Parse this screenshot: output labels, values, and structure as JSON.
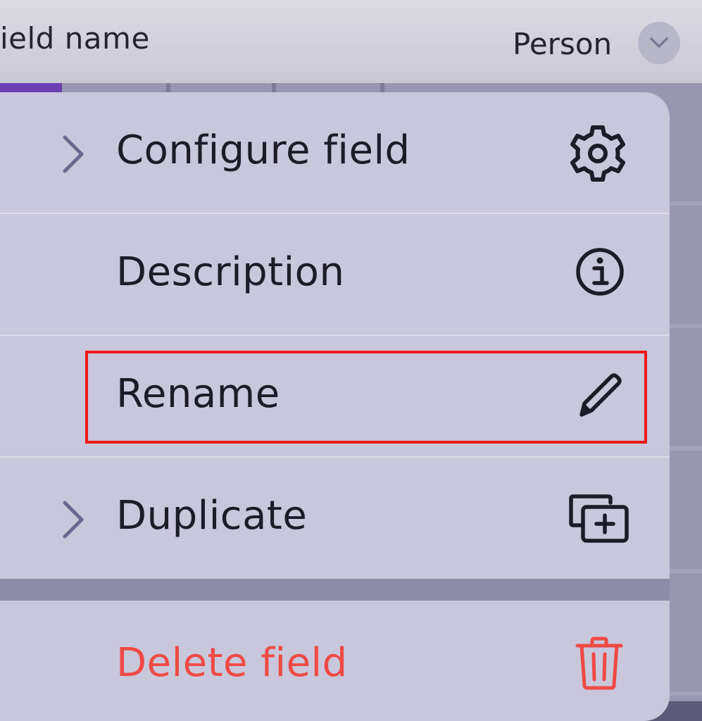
{
  "header": {
    "field_name_label": "ield name",
    "person_label": "Person"
  },
  "menu": {
    "items": [
      {
        "label": "Configure field",
        "has_submenu": true,
        "icon": "gear-icon"
      },
      {
        "label": "Description",
        "has_submenu": false,
        "icon": "info-icon"
      },
      {
        "label": "Rename",
        "has_submenu": false,
        "icon": "pencil-icon",
        "highlighted": true
      },
      {
        "label": "Duplicate",
        "has_submenu": true,
        "icon": "duplicate-icon"
      }
    ],
    "danger_item": {
      "label": "Delete field",
      "icon": "trash-icon"
    }
  },
  "colors": {
    "menu_background": "#c9c7db",
    "text": "#1c1c28",
    "danger": "#ef4a44",
    "chevron": "#6b6890",
    "highlight_border": "#ee1a1a"
  }
}
